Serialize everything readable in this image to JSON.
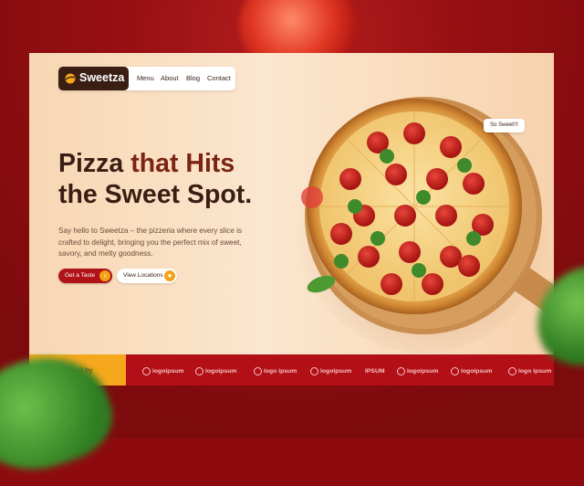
{
  "brand": {
    "name": "Sweetza",
    "accent": "#b01218",
    "dark": "#3a1e14",
    "yellow": "#f5a81c"
  },
  "nav": {
    "items": [
      "Menu",
      "About",
      "Blog",
      "Contact"
    ]
  },
  "hero": {
    "title_part1": "Pizza",
    "title_accent": "that Hits",
    "title_line2": "the Sweet Spot.",
    "description": "Say hello to Sweetza – the pizzeria where every slice is crafted to delight, bringing you the perfect mix of sweet, savory, and melty goodness.",
    "primary_button": {
      "label": "Get a Taste",
      "icon": "arrow-icon"
    },
    "secondary_button": {
      "label": "View Locations",
      "icon": "location-icon"
    }
  },
  "badge": {
    "text": "So Sweet!!!"
  },
  "trusted": {
    "label": "Trusted by",
    "logos": [
      "logoipsum",
      "logoipsum",
      "logo ipsum",
      "logoipsum",
      "IPSUM",
      "logoipsum",
      "logoipsum",
      "logo ipsum"
    ]
  }
}
